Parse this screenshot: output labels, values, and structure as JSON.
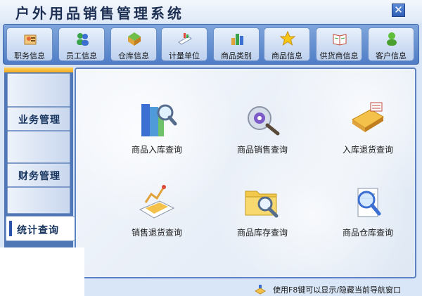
{
  "window": {
    "title": "户外用品销售管理系统",
    "close_glyph": "✕"
  },
  "toolbar": {
    "items": [
      {
        "label": "职务信息",
        "icon": "job-icon"
      },
      {
        "label": "员工信息",
        "icon": "staff-icon"
      },
      {
        "label": "仓库信息",
        "icon": "warehouse-icon"
      },
      {
        "label": "计量单位",
        "icon": "unit-icon"
      },
      {
        "label": "商品类别",
        "icon": "category-icon"
      },
      {
        "label": "商品信息",
        "icon": "star-icon"
      },
      {
        "label": "供货商信息",
        "icon": "supplier-icon"
      },
      {
        "label": "客户信息",
        "icon": "customer-icon"
      }
    ]
  },
  "sidebar": {
    "tabs": [
      {
        "label": "业务管理",
        "active": false
      },
      {
        "label": "财务管理",
        "active": false
      },
      {
        "label": "统计查询",
        "active": true
      }
    ]
  },
  "main": {
    "items": [
      {
        "label": "商品入库查询",
        "icon": "book-search-icon"
      },
      {
        "label": "商品销售查询",
        "icon": "cd-search-icon"
      },
      {
        "label": "入库退货查询",
        "icon": "laptop-return-icon"
      },
      {
        "label": "销售退货查询",
        "icon": "chart-return-icon"
      },
      {
        "label": "商品库存查询",
        "icon": "folder-search-icon"
      },
      {
        "label": "商品仓库查询",
        "icon": "document-search-icon"
      }
    ]
  },
  "statusbar": {
    "text": "使用F8键可以显示/隐藏当前导航窗口"
  }
}
